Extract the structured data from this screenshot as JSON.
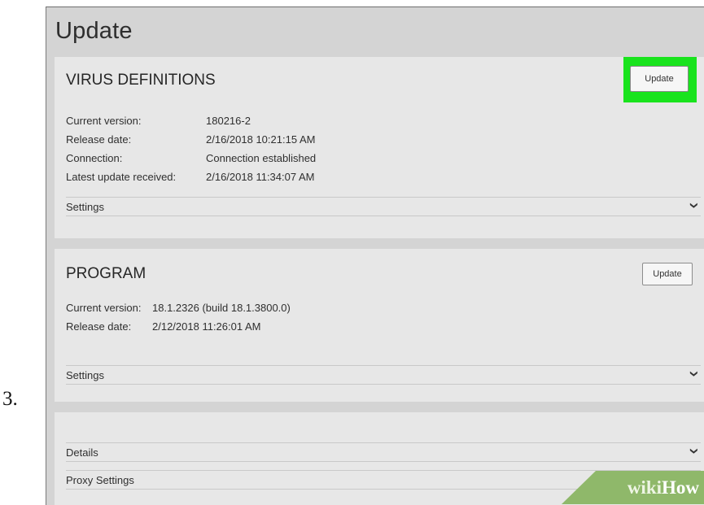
{
  "step_number": "3.",
  "page_title": "Update",
  "virus_definitions": {
    "title": "VIRUS DEFINITIONS",
    "update_button": "Update",
    "rows": [
      {
        "label": "Current version:",
        "value": "180216-2"
      },
      {
        "label": "Release date:",
        "value": "2/16/2018 10:21:15 AM"
      },
      {
        "label": "Connection:",
        "value": "Connection established"
      },
      {
        "label": "Latest update received:",
        "value": "2/16/2018 11:34:07 AM"
      }
    ],
    "settings_label": "Settings"
  },
  "program": {
    "title": "PROGRAM",
    "update_button": "Update",
    "rows": [
      {
        "label": "Current version:",
        "value": "18.1.2326 (build 18.1.3800.0)"
      },
      {
        "label": "Release date:",
        "value": "2/12/2018 11:26:01 AM"
      }
    ],
    "settings_label": "Settings"
  },
  "misc": {
    "details_label": "Details",
    "proxy_label": "Proxy Settings"
  },
  "watermark": {
    "part1": "wiki",
    "part2": "How"
  },
  "colors": {
    "highlight": "#19e31d",
    "panel_bg": "#e7e7e7",
    "app_bg": "#d4d4d4"
  }
}
